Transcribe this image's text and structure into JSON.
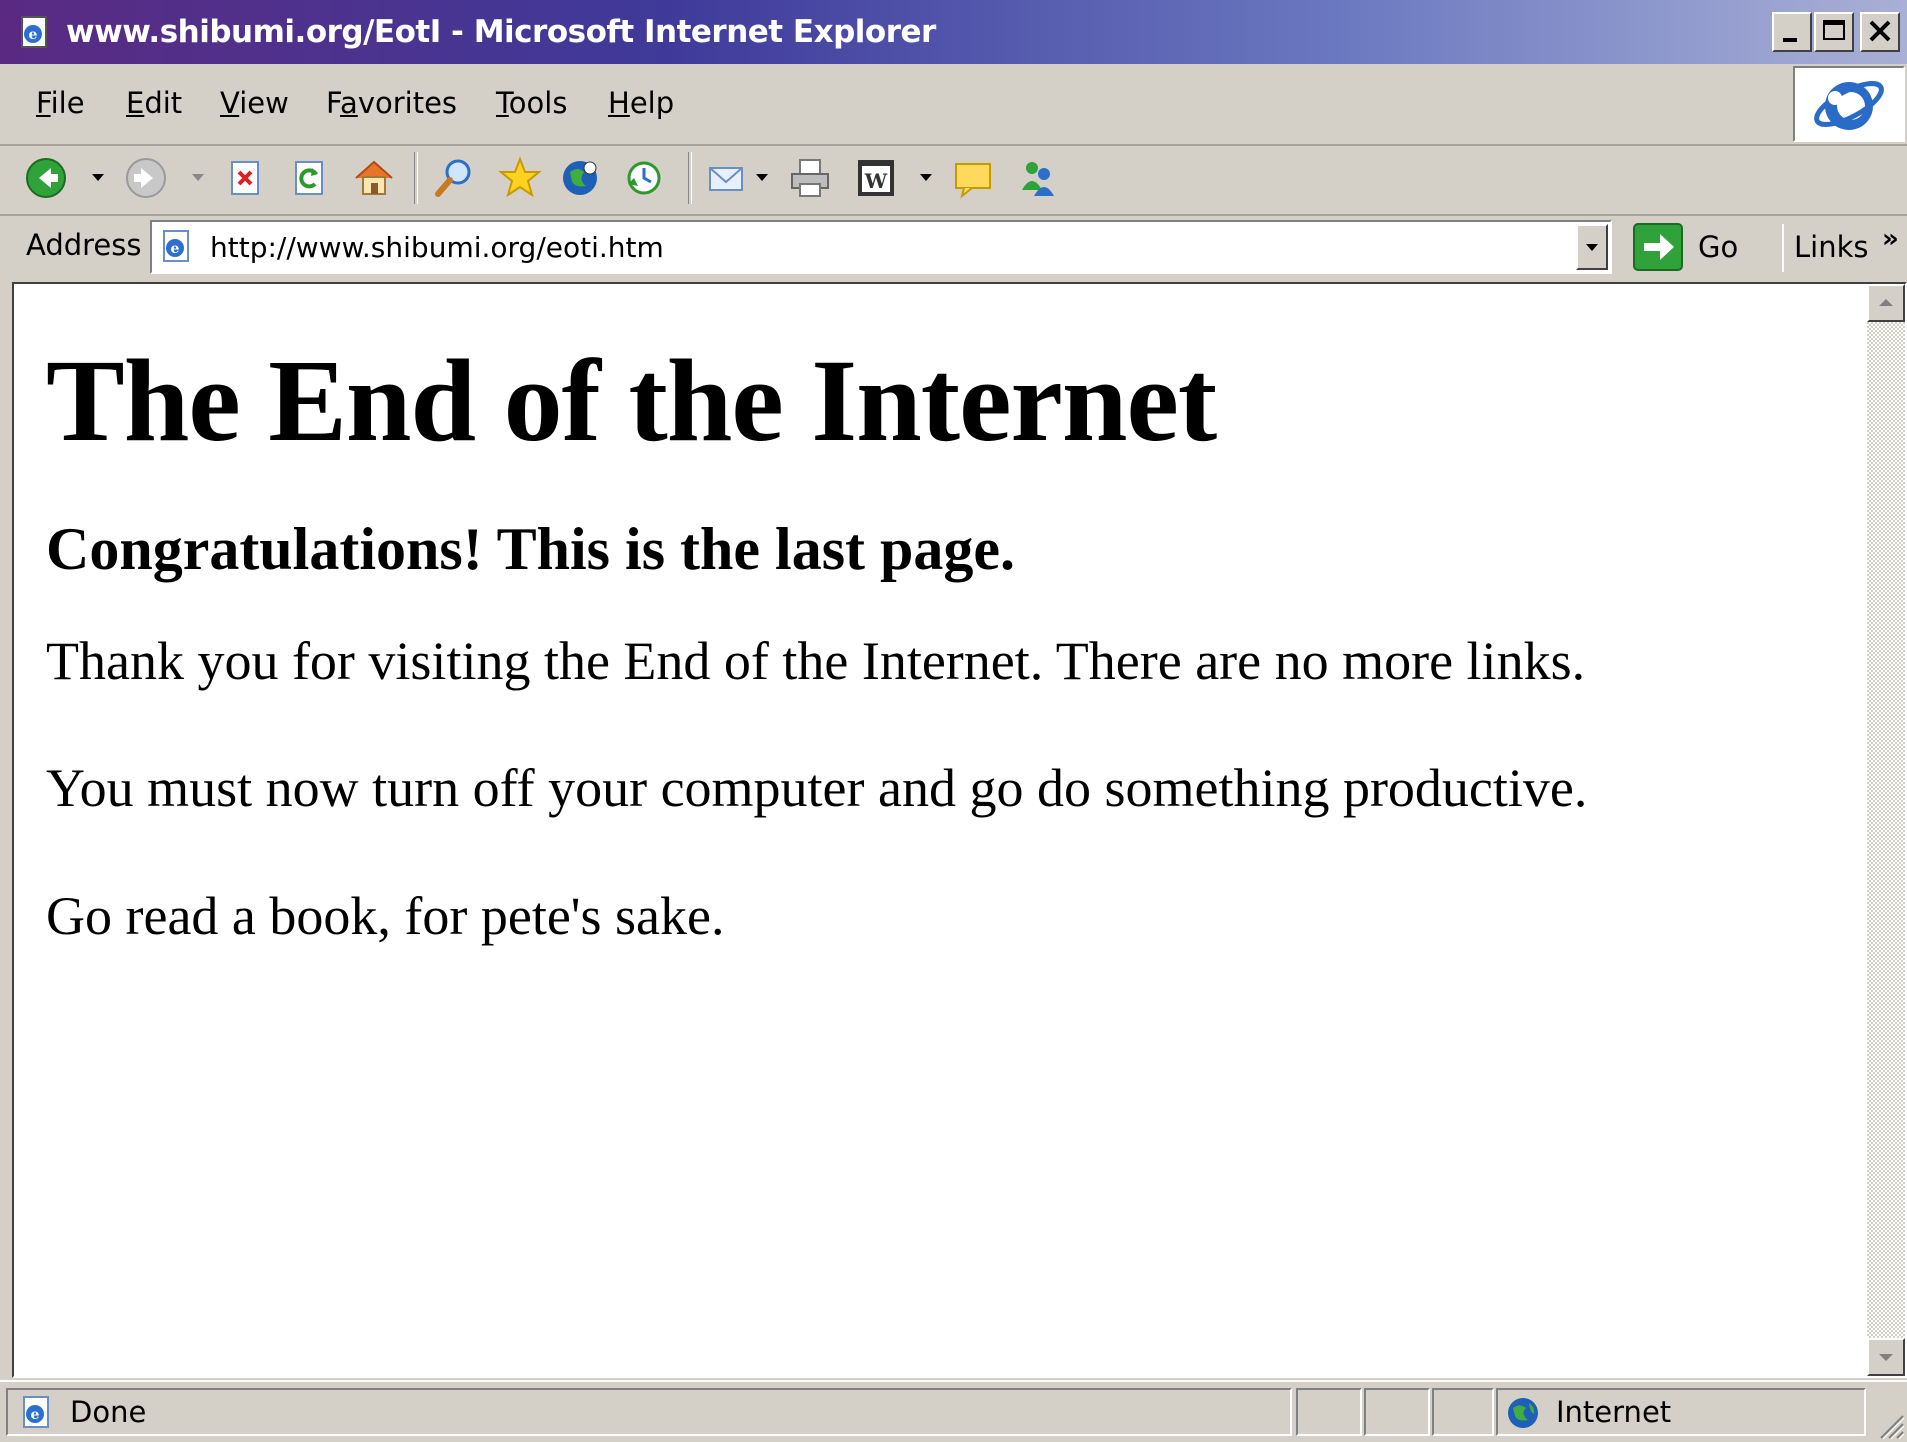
{
  "window": {
    "title": "www.shibumi.org/EotI - Microsoft Internet Explorer"
  },
  "menu": {
    "items": [
      {
        "label": "File",
        "accel": "F"
      },
      {
        "label": "Edit",
        "accel": "E"
      },
      {
        "label": "View",
        "accel": "V"
      },
      {
        "label": "Favorites",
        "accel": "a"
      },
      {
        "label": "Tools",
        "accel": "T"
      },
      {
        "label": "Help",
        "accel": "H"
      }
    ]
  },
  "toolbar": {
    "icons": [
      "back-icon",
      "forward-icon",
      "stop-icon",
      "refresh-icon",
      "home-icon",
      "search-icon",
      "favorites-icon",
      "media-icon",
      "history-icon",
      "mail-icon",
      "print-icon",
      "edit-word-icon",
      "discuss-icon",
      "messenger-icon"
    ]
  },
  "address": {
    "label": "Address",
    "url": "http://www.shibumi.org/eoti.htm",
    "go_label": "Go",
    "links_label": "Links",
    "links_chevron": "»"
  },
  "page": {
    "heading": "The End of the Internet",
    "subheading": "Congratulations! This is the last page.",
    "paragraphs": [
      "Thank you for visiting the End of the Internet. There are no more links.",
      "You must now turn off your computer and go do something productive.",
      "Go read a book, for pete's sake."
    ]
  },
  "status": {
    "text": "Done",
    "zone": "Internet"
  },
  "colors": {
    "chrome": "#d4d0c8",
    "title_start": "#5a2a82",
    "title_end": "#a9b0d6"
  }
}
